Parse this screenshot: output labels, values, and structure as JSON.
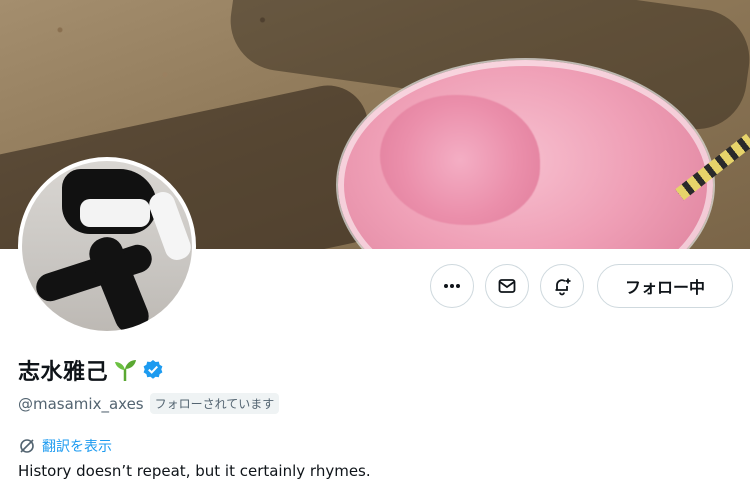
{
  "profile": {
    "display_name": "志水雅己",
    "handle": "@masamix_axes",
    "follows_you_badge": "フォローされています",
    "translate_link": "翻訳を表示",
    "bio": "History doesn’t repeat, but it certainly rhymes.",
    "verified": true
  },
  "actions": {
    "more_icon": "more-horizontal-icon",
    "message_icon": "mail-icon",
    "notify_icon": "bell-plus-icon",
    "follow_label": "フォロー中"
  },
  "colors": {
    "accent": "#1d9bf0",
    "text_primary": "#0f1419",
    "text_secondary": "#536471",
    "border": "#cfd9de",
    "sprout": "#5aa832"
  }
}
